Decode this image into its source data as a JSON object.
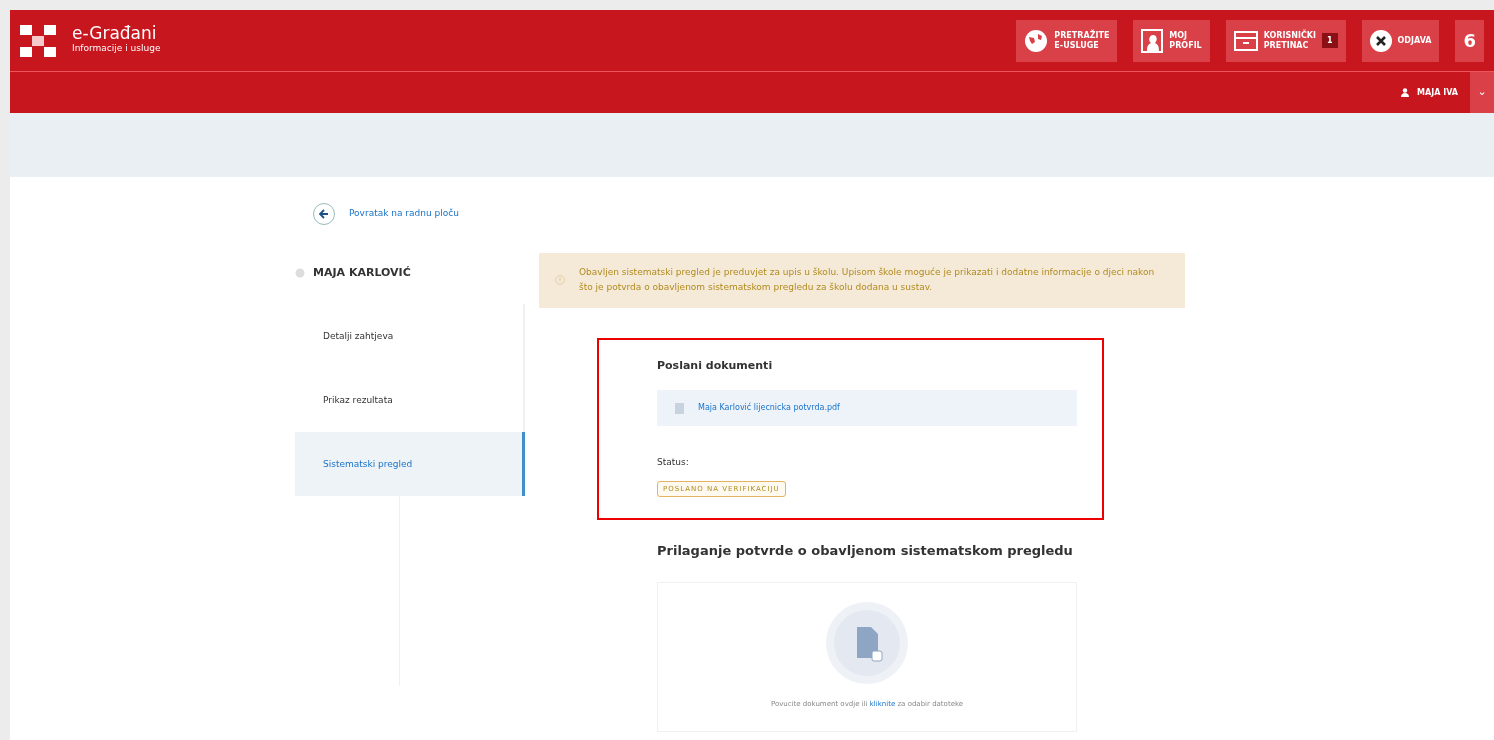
{
  "brand": {
    "title": "e-Građani",
    "subtitle": "Informacije i usluge"
  },
  "header_buttons": [
    {
      "kind": "globe",
      "label_lines": [
        "PRETRAŽITE",
        "E-USLUGE"
      ]
    },
    {
      "kind": "profile",
      "label_lines": [
        "MOJ",
        "PROFIL"
      ]
    },
    {
      "kind": "inbox",
      "label_lines": [
        "KORISNIČKI",
        "PRETINAC"
      ],
      "badge": "1"
    },
    {
      "kind": "logout",
      "label_lines": [
        "ODJAVA"
      ]
    },
    {
      "kind": "plain",
      "label_lines": [
        "6"
      ]
    }
  ],
  "user_bar": {
    "name": "MAJA IVA",
    "caret": "⌄"
  },
  "back_link": "Povratak na radnu ploču",
  "person": "MAJA KARLOVIĆ",
  "sidebar": {
    "items": [
      {
        "label": "Detalji zahtjeva",
        "selected": false
      },
      {
        "label": "Prikaz rezultata",
        "selected": false
      },
      {
        "label": "Sistematski pregled",
        "selected": true
      }
    ]
  },
  "alert": "Obavljen sistematski pregled je preduvjet za upis u školu. Upisom škole moguće je prikazati i dodatne informacije o djeci nakon što je potvrda o obavljenom sistematskom pregledu za školu dodana u sustav.",
  "sent_documents": {
    "title": "Poslani dokumenti",
    "files": [
      "Maja Karlović lijecnicka potvrda.pdf"
    ],
    "status_label": "Status:",
    "status": "POSLANO NA VERIFIKACIJU"
  },
  "upload": {
    "title": "Prilaganje potvrde o obavljenom sistematskom pregledu",
    "hint_before": "Povucite dokument ovdje ili",
    "hint_link": "kliknite",
    "hint_after": "za odabir datoteke"
  }
}
